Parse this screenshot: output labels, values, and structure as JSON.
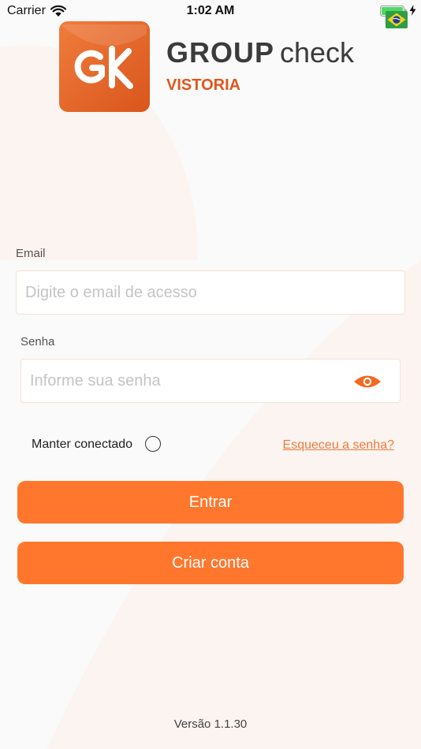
{
  "status_bar": {
    "carrier": "Carrier",
    "time": "1:02 AM",
    "wifi_icon": "wifi-icon",
    "battery_icon": "battery-charging-icon",
    "flag_icon": "brazil-flag-icon"
  },
  "brand": {
    "logo_icon": "gk-logo-icon",
    "name_strong": "GROUP",
    "name_light": "check",
    "subtitle": "VISTORIA",
    "accent_color": "#e0561c"
  },
  "login": {
    "email_label": "Email",
    "email_placeholder": "Digite o email de acesso",
    "email_value": "",
    "password_label": "Senha",
    "password_placeholder": "Informe sua senha",
    "password_value": "",
    "show_password_icon": "eye-icon",
    "remember_label": "Manter conectado",
    "remember_checked": false,
    "forgot_link": "Esqueceu a senha?"
  },
  "buttons": {
    "login": "Entrar",
    "create_account": "Criar conta",
    "color": "#ff772d"
  },
  "footer": {
    "version": "Versão 1.1.30"
  }
}
